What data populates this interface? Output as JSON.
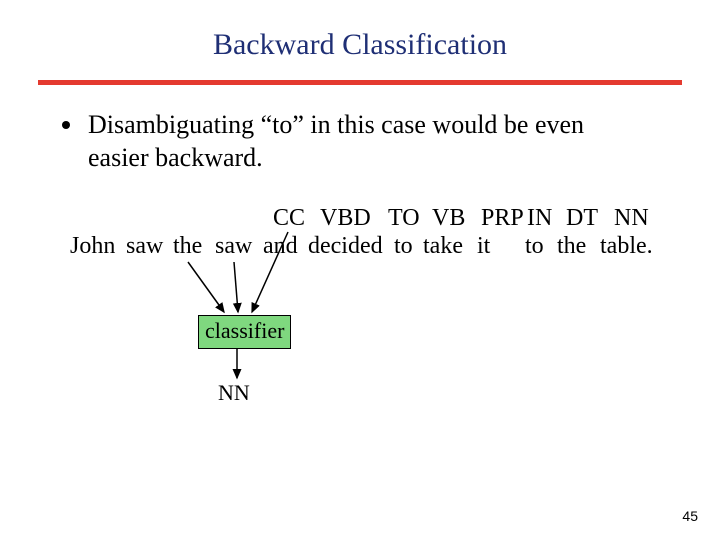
{
  "title": "Backward Classification",
  "bullet": "Disambiguating “to” in this case would be even easier backward.",
  "tags": {
    "cc": "CC",
    "vbd": "VBD",
    "to": "TO",
    "vb": "VB",
    "prp": "PRP",
    "in": "IN",
    "dt": "DT",
    "nn": "NN"
  },
  "words": {
    "john": "John",
    "saw1": "saw",
    "the1": "the",
    "saw2": "saw",
    "and": "and",
    "decided": "decided",
    "to1": "to",
    "take": "take",
    "it": "it",
    "to2": "to",
    "the2": "the",
    "table": "table."
  },
  "classifier_label": "classifier",
  "output_label": "NN",
  "page_number": "45"
}
